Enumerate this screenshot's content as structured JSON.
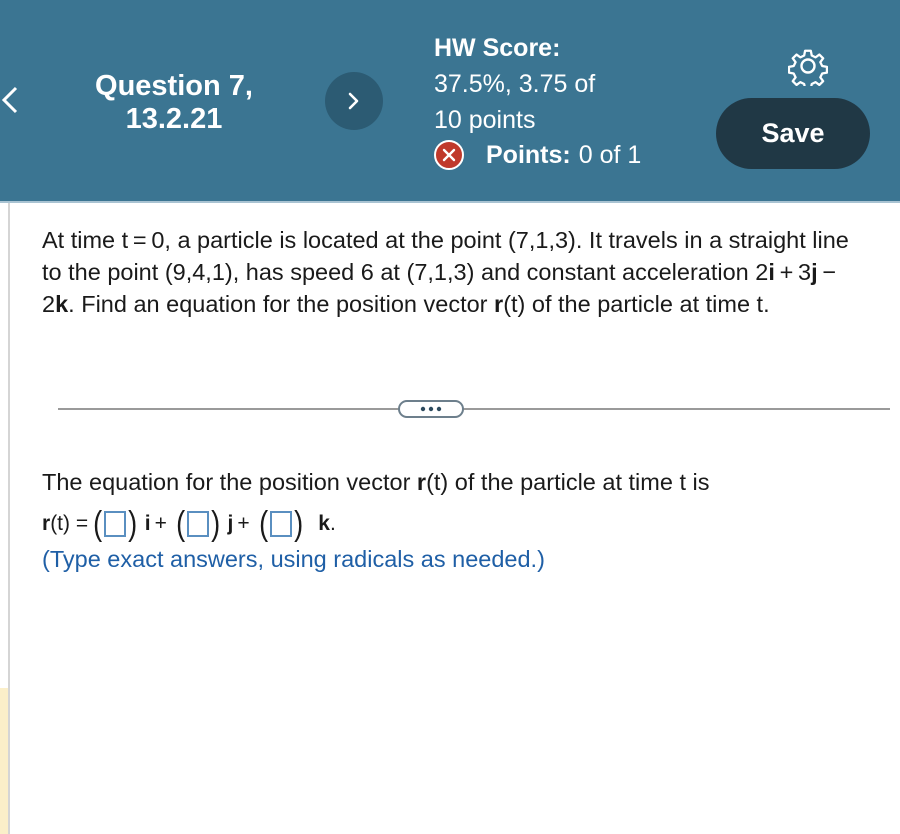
{
  "header": {
    "question_title": "Question 7,\n13.2.21",
    "hw_score_label": "HW Score:",
    "hw_score_line1": "37.5%, 3.75 of",
    "hw_score_line2": "10 points",
    "points_label": "Points:",
    "points_value": "0 of 1",
    "save_label": "Save"
  },
  "question": {
    "p1": "At time t = 0, a particle is located at the point (7,1,3). It travels in a straight line to the point (9,4,1), has speed 6 at (7,1,3) and constant acceleration 2",
    "i": "i",
    "p2": " + 3",
    "j": "j",
    "p3": " − 2",
    "k": "k",
    "p4": ". Find an equation for the position vector ",
    "r": "r",
    "p5": "(t) of the particle at time t."
  },
  "answer": {
    "intro_pre": "The equation for the position vector ",
    "intro_r": "r",
    "intro_post": "(t) of the particle at time t is",
    "eq_lhs_r": "r",
    "eq_lhs_rest": "(t) = ",
    "unit_i": "i",
    "unit_j": "j",
    "unit_k": "k",
    "plus": "+",
    "period": ".",
    "hint": "(Type exact answers, using radicals as needed.)"
  },
  "colors": {
    "header_bg": "#3b7592",
    "save_bg": "#203845",
    "error_badge": "#c0392b",
    "hint_text": "#1f5fa6",
    "input_border": "#5a8fc0"
  }
}
